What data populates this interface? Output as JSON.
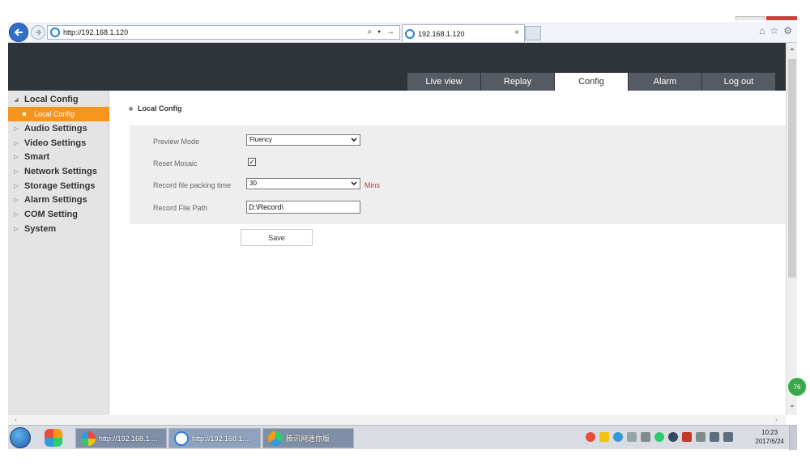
{
  "browser": {
    "url": "http://192.168.1.120",
    "tab_title": "192.168.1.120",
    "tab_close": "×",
    "address_tools": "⌕ ▾ →"
  },
  "nav": {
    "items": [
      "Live view",
      "Replay",
      "Config",
      "Alarm",
      "Log out"
    ],
    "active": "Config"
  },
  "sidebar": {
    "groups": [
      {
        "label": "Local Config",
        "expanded": true
      },
      {
        "label": "Audio Settings"
      },
      {
        "label": "Video Settings"
      },
      {
        "label": "Smart"
      },
      {
        "label": "Network Settings"
      },
      {
        "label": "Storage Settings"
      },
      {
        "label": "Alarm Settings"
      },
      {
        "label": "COM Setting"
      },
      {
        "label": "System"
      }
    ],
    "sub_item": "Local Config"
  },
  "main": {
    "section_title": "Local Config",
    "preview_mode_label": "Preview Mode",
    "preview_mode_value": "Fluency",
    "reset_mosaic_label": "Reset Mosaic",
    "reset_mosaic_checked": true,
    "record_packing_label": "Record file packing time",
    "record_packing_value": "30",
    "record_packing_unit": "Mins",
    "record_path_label": "Record File Path",
    "record_path_value": "D:\\Record\\",
    "save_label": "Save"
  },
  "taskbar": {
    "buttons": [
      "http://192.168.1....",
      "http://192.168.1....",
      "腾讯网迷你版"
    ],
    "clock_time": "10:23",
    "clock_date": "2017/6/24",
    "badge": "76"
  },
  "colors": {
    "header": "#2f333a",
    "accent_orange": "#f7941e",
    "nav_tab": "#565b63",
    "mins_red": "#c0392b"
  }
}
